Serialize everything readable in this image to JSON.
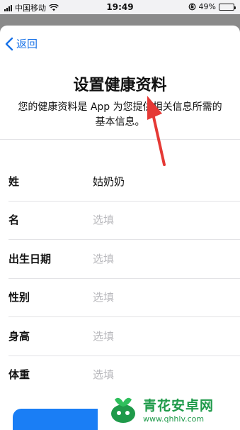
{
  "status_bar": {
    "carrier": "中国移动",
    "time": "19:49",
    "battery_text": "49%",
    "battery_level": 0.49,
    "icons": [
      "signal-icon",
      "wifi-icon",
      "orientation-lock-icon",
      "battery-icon"
    ]
  },
  "nav": {
    "back_label": "返回"
  },
  "header": {
    "title": "设置健康资料",
    "subtitle": "您的健康资料是 App 为您提供相关信息所需的基本信息。"
  },
  "form": {
    "rows": [
      {
        "label": "姓",
        "value": "姑奶奶",
        "is_placeholder": false
      },
      {
        "label": "名",
        "value": "选填",
        "is_placeholder": true
      },
      {
        "label": "出生日期",
        "value": "选填",
        "is_placeholder": true
      },
      {
        "label": "性别",
        "value": "选填",
        "is_placeholder": true
      },
      {
        "label": "身高",
        "value": "选填",
        "is_placeholder": true
      },
      {
        "label": "体重",
        "value": "选填",
        "is_placeholder": true
      }
    ]
  },
  "colors": {
    "accent": "#1a7ef5",
    "annotation_arrow": "#e53935",
    "watermark_green": "#1f9a4a"
  },
  "watermark": {
    "name": "青花安卓网",
    "url": "www.qhhlv.com"
  }
}
